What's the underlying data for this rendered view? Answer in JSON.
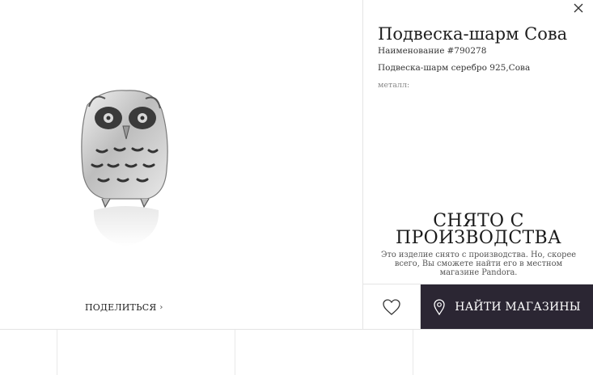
{
  "product": {
    "title": "Подвеска-шарм Сова",
    "sku_label": "Наименование",
    "sku_number": "#790278",
    "description": "Подвеска-шарм серебро 925,Сова",
    "metal_label": "металл:"
  },
  "discontinued": {
    "title": "СНЯТО С ПРОИЗВОДСТВА",
    "text": "Это изделие снято с производства. Но, скорее всего, Вы сможете найти его в местном магазине Pandora."
  },
  "actions": {
    "share_label": "ПОДЕЛИТЬСЯ",
    "find_stores_label": "НАЙТИ МАГАЗИНЫ"
  },
  "icons": {
    "close": "close-icon",
    "heart": "heart-icon",
    "location": "location-pin-icon",
    "chevron": "chevron-right-icon"
  },
  "colors": {
    "accent_dark": "#2b2633",
    "border": "#e4e4e4",
    "text": "#2a2a2a"
  }
}
